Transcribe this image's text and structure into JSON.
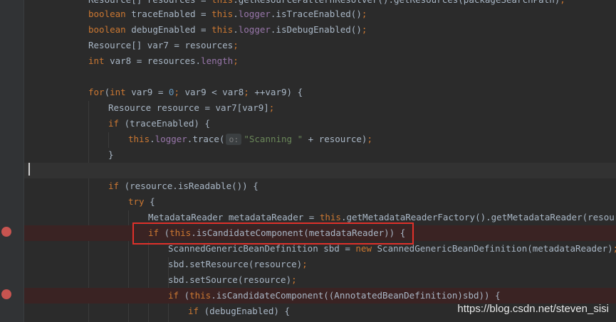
{
  "editor": {
    "lines": [
      {
        "tokens": [
          [
            "plain",
            "Resource[] resources = "
          ],
          [
            "kw",
            "this"
          ],
          [
            "plain",
            ".getResourcePatternResolver().getResources(packageSearchPath)"
          ],
          [
            "pun",
            ";"
          ]
        ]
      },
      {
        "tokens": [
          [
            "kw",
            "boolean "
          ],
          [
            "plain",
            "traceEnabled = "
          ],
          [
            "kw",
            "this"
          ],
          [
            "plain",
            "."
          ],
          [
            "fld",
            "logger"
          ],
          [
            "plain",
            ".isTraceEnabled()"
          ],
          [
            "pun",
            ";"
          ]
        ]
      },
      {
        "tokens": [
          [
            "kw",
            "boolean "
          ],
          [
            "plain",
            "debugEnabled = "
          ],
          [
            "kw",
            "this"
          ],
          [
            "plain",
            "."
          ],
          [
            "fld",
            "logger"
          ],
          [
            "plain",
            ".isDebugEnabled()"
          ],
          [
            "pun",
            ";"
          ]
        ]
      },
      {
        "tokens": [
          [
            "plain",
            "Resource[] var7 = resources"
          ],
          [
            "pun",
            ";"
          ]
        ]
      },
      {
        "tokens": [
          [
            "kw",
            "int "
          ],
          [
            "plain",
            "var8 = resources."
          ],
          [
            "fld",
            "length"
          ],
          [
            "pun",
            ";"
          ]
        ]
      },
      {
        "tokens": []
      },
      {
        "tokens": [
          [
            "kw",
            "for"
          ],
          [
            "plain",
            "("
          ],
          [
            "kw",
            "int "
          ],
          [
            "plain",
            "var9 = "
          ],
          [
            "num",
            "0"
          ],
          [
            "pun",
            "; "
          ],
          [
            "plain",
            "var9 < var8"
          ],
          [
            "pun",
            "; "
          ],
          [
            "plain",
            "++var9) {"
          ]
        ]
      },
      {
        "tokens": [
          [
            "plain",
            "Resource resource = var7[var9]"
          ],
          [
            "pun",
            ";"
          ]
        ]
      },
      {
        "tokens": [
          [
            "kw",
            "if "
          ],
          [
            "plain",
            "(traceEnabled) {"
          ]
        ]
      },
      {
        "tokens": [
          [
            "kw",
            "this"
          ],
          [
            "plain",
            "."
          ],
          [
            "fld",
            "logger"
          ],
          [
            "plain",
            ".trace("
          ],
          [
            "hint",
            "o:"
          ],
          [
            "str",
            "\"Scanning \" "
          ],
          [
            "plain",
            "+ resource)"
          ],
          [
            "pun",
            ";"
          ]
        ]
      },
      {
        "tokens": [
          [
            "plain",
            "}"
          ]
        ]
      },
      {
        "tokens": []
      },
      {
        "tokens": [
          [
            "kw",
            "if "
          ],
          [
            "plain",
            "(resource.isReadable()) {"
          ]
        ]
      },
      {
        "tokens": [
          [
            "kw",
            "try "
          ],
          [
            "plain",
            "{"
          ]
        ]
      },
      {
        "tokens": [
          [
            "plain",
            "MetadataReader metadataReader = "
          ],
          [
            "kw",
            "this"
          ],
          [
            "plain",
            ".getMetadataReaderFactory().getMetadataReader(resource)"
          ],
          [
            "pun",
            ";"
          ]
        ]
      },
      {
        "tokens": [
          [
            "kw",
            "if "
          ],
          [
            "plain",
            "("
          ],
          [
            "kw",
            "this"
          ],
          [
            "plain",
            ".isCandidateComponent(metadataReader)) {"
          ]
        ]
      },
      {
        "tokens": [
          [
            "plain",
            "ScannedGenericBeanDefinition sbd = "
          ],
          [
            "kw",
            "new "
          ],
          [
            "plain",
            "ScannedGenericBeanDefinition(metadataReader)"
          ],
          [
            "pun",
            ";"
          ]
        ]
      },
      {
        "tokens": [
          [
            "plain",
            "sbd.setResource(resource)"
          ],
          [
            "pun",
            ";"
          ]
        ]
      },
      {
        "tokens": [
          [
            "plain",
            "sbd.setSource(resource)"
          ],
          [
            "pun",
            ";"
          ]
        ]
      },
      {
        "tokens": [
          [
            "kw",
            "if "
          ],
          [
            "plain",
            "("
          ],
          [
            "kw",
            "this"
          ],
          [
            "plain",
            ".isCandidateComponent((AnnotatedBeanDefinition)sbd)) {"
          ]
        ]
      },
      {
        "tokens": [
          [
            "kw",
            "if "
          ],
          [
            "plain",
            "(debugEnabled) {"
          ]
        ]
      }
    ]
  },
  "watermark": "https://blog.csdn.net/steven_sisi"
}
